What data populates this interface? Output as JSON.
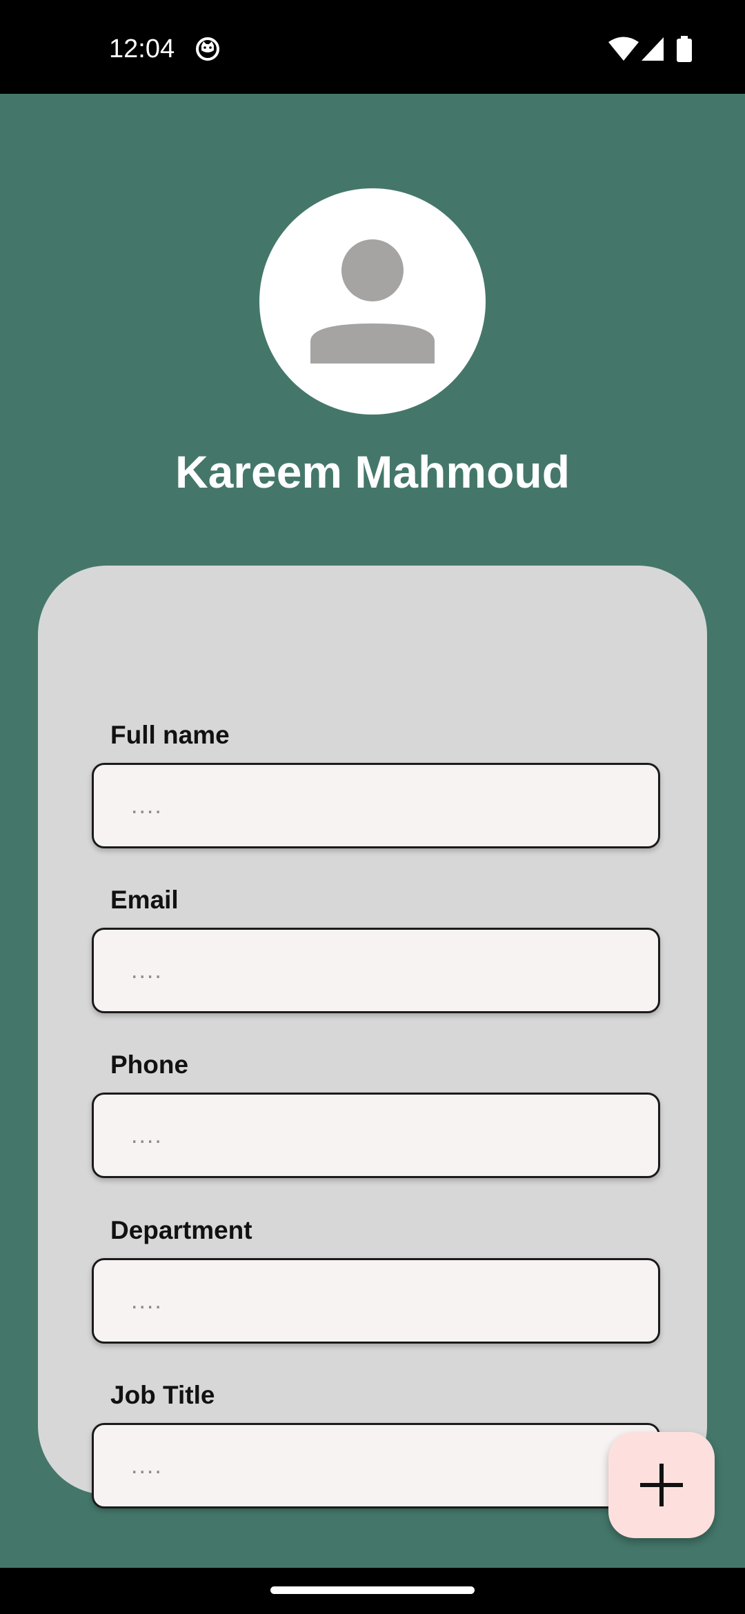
{
  "status_bar": {
    "time": "12:04",
    "icons": [
      "notification-cat-icon",
      "wifi-icon",
      "signal-icon",
      "battery-icon"
    ]
  },
  "profile": {
    "name": "Kareem Mahmoud",
    "avatar_icon": "person-placeholder-icon"
  },
  "form": {
    "fields": [
      {
        "label": "Full name",
        "placeholder": "....",
        "value": ""
      },
      {
        "label": "Email",
        "placeholder": "....",
        "value": ""
      },
      {
        "label": "Phone",
        "placeholder": "....",
        "value": ""
      },
      {
        "label": "Department",
        "placeholder": "....",
        "value": ""
      },
      {
        "label": "Job Title",
        "placeholder": "....",
        "value": ""
      }
    ]
  },
  "fab": {
    "icon": "plus-icon"
  },
  "colors": {
    "background": "#44776a",
    "card": "#d7d7d7",
    "input_fill": "#f7f3f2",
    "fab": "#fde0dd"
  }
}
